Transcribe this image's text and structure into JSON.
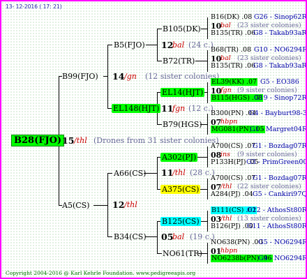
{
  "header": {
    "date": "13- 12-2016 ( 17: 21)"
  },
  "footer": {
    "copyright": "Copyright 2004-2016 @ Karl Kehrle Foundation.   www.pedigreeapis.org"
  },
  "root": {
    "id": "B28(FJO)",
    "year": "15",
    "breeder": "/thl",
    "note": "(Drones from 31 sister colonies)"
  },
  "gen1": [
    {
      "id": "B99(FJO)",
      "year": "14",
      "breeder": "/gn",
      "note": "(12 sister colonies)"
    },
    {
      "id": "A5(CS)",
      "year": "12",
      "breeder": "/thl"
    }
  ],
  "gen2": [
    {
      "id": "B5(FJO)"
    },
    {
      "id": "EL148(HJT)"
    },
    {
      "id": "A66(CS)"
    },
    {
      "id": "B34(CS)"
    }
  ],
  "gen3": [
    {
      "id": "B105(DK)",
      "year": "12",
      "breeder": "bal",
      "note": "(24 c.)"
    },
    {
      "id": "B72(TR)"
    },
    {
      "id": "EL14(HJT)",
      "year": "11",
      "breeder": "fgn",
      "note": "(12 c.)"
    },
    {
      "id": "B79(HGS)"
    },
    {
      "id": "A302(PJ)",
      "year": "11",
      "breeder": "/thl",
      "note": "(28 c.)"
    },
    {
      "id": "A375(CS)"
    },
    {
      "id": "B125(CS)",
      "year": "05",
      "breeder": "bal",
      "note": "(19 c.)"
    },
    {
      "id": "NO61(TR)"
    }
  ],
  "gen4": [
    {
      "top": "B16(DK) .08",
      "top_hl": "",
      "top_src": "G26 - Sinop62R",
      "year": "10",
      "breeder": "bal",
      "note": "(23 sister colonies)",
      "bot": "B135(TR) .06",
      "bot_hl": "",
      "bot_src": "G8 - Takab93aR"
    },
    {
      "top": "B68(TR) .08",
      "top_hl": "",
      "top_src": "G10 - NO6294R",
      "year": "10",
      "breeder": "bal",
      "note": "(23 sister colonies)",
      "bot": "B135(TR) .06",
      "bot_hl": "",
      "bot_src": "G8 - Takab93aR"
    },
    {
      "top": "EL39(KK) .07",
      "top_hl": "green",
      "top_src": "G5 - EO386",
      "year": "10",
      "breeder": "fgn",
      "note": "(9 sister colonies)",
      "bot": "B115(HGS) .08",
      "bot_hl": "green",
      "bot_src": "G19 - Sinop72R"
    },
    {
      "top": "B300(PN) .04",
      "top_hl": "",
      "top_src": "G4 - Bayburt98-3",
      "year": "07",
      "breeder": "hbpn",
      "note": "",
      "bot": "MG081(PN) .05",
      "bot_hl": "green",
      "bot_src": "G1 - Margret04R"
    },
    {
      "top": "A700(CS) .07",
      "top_hl": "",
      "top_src": "G1 - Bozdag07R",
      "year": "08",
      "breeder": "ins",
      "note": "(9 sister colonies)",
      "bot": "P133H(PJ) .05",
      "bot_hl": "",
      "bot_src": "G3 - PrimGreen00"
    },
    {
      "top": "A700(CS) .07",
      "top_hl": "",
      "top_src": "G1 - Bozdag07R",
      "year": "07",
      "breeder": "/thl",
      "note": "(22 sister colonies)",
      "bot": "A284(PJ) .04",
      "bot_hl": "",
      "bot_src": "G5 - Cankiri97Q"
    },
    {
      "top": "B111(CS) .02",
      "top_hl": "cyan",
      "top_src": "G12 - AthosSt80R",
      "year": "03",
      "breeder": "/thl",
      "note": "(13 sister colonies)",
      "bot": "B126(PJ) .00",
      "bot_hl": "",
      "bot_src": "G11 - AthosSt80R"
    },
    {
      "top": "NO638(PN) .00",
      "top_hl": "",
      "top_src": "G5 - NO6294R",
      "year": "01",
      "breeder": "hbpn",
      "note": "",
      "bot": "NO6238b(PN) .96",
      "bot_hl": "green",
      "bot_src": "G4 - NO6294R"
    }
  ]
}
